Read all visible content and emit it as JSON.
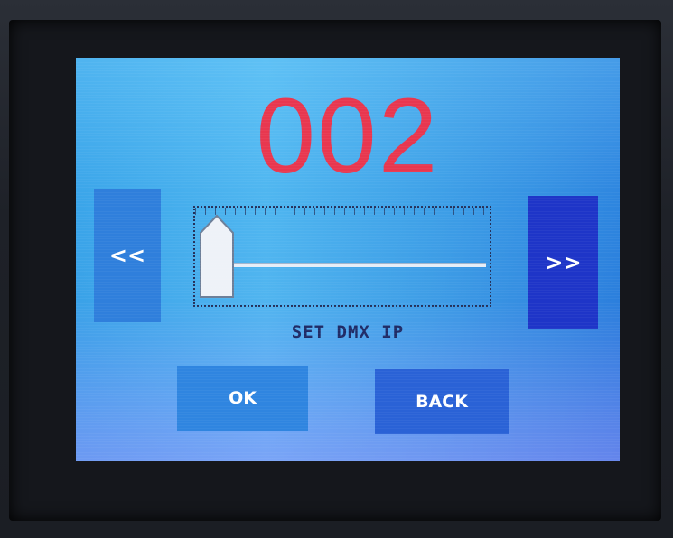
{
  "display": {
    "value": "002",
    "caption": "SET DMX IP",
    "slider_level": 0.0
  },
  "navigation": {
    "prev_label": "<<",
    "next_label": ">>"
  },
  "actions": {
    "ok_label": "OK",
    "back_label": "BACK"
  },
  "colors": {
    "value_text": "#e8374f",
    "screen_background": "#3aa4e8",
    "next_button": "#1e35c8",
    "prev_button": "#2f7fdc",
    "caption_text": "#1f2b66"
  }
}
